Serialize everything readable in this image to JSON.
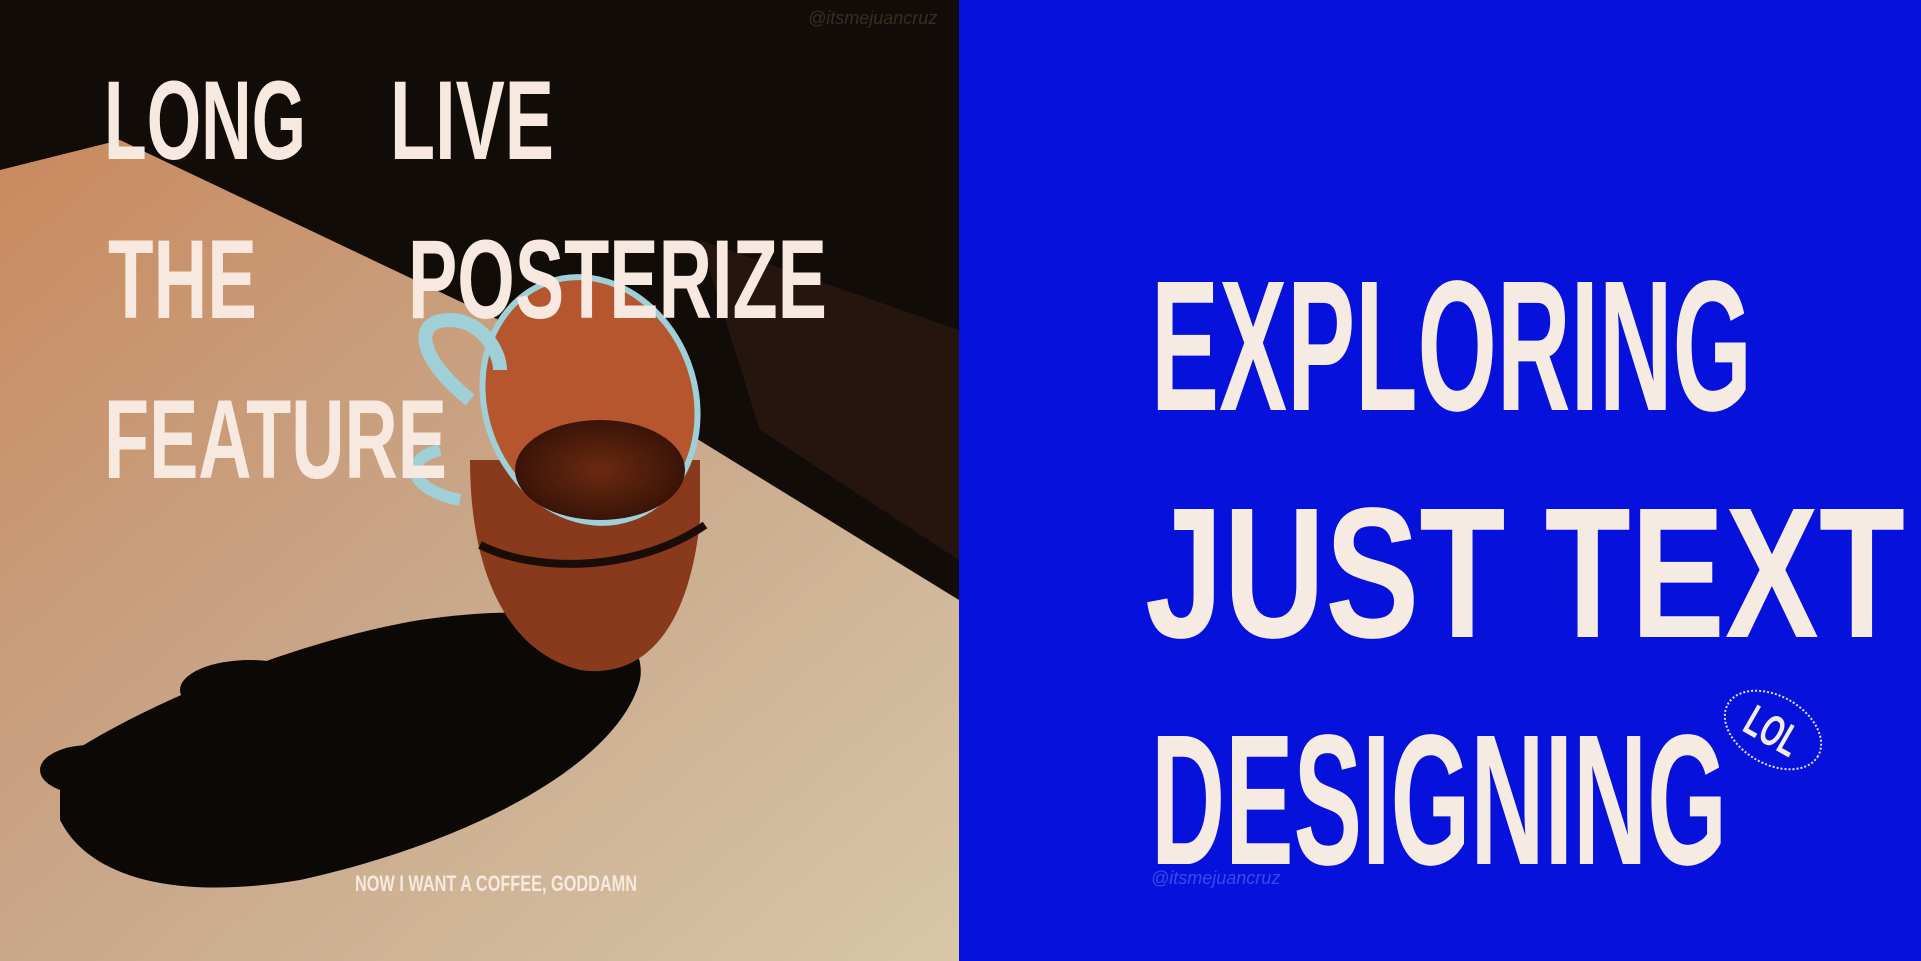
{
  "left_poster": {
    "title_lines": [
      {
        "a": "LONG",
        "b": "LIVE"
      },
      {
        "a": "THE",
        "b": "POSTERIZE"
      },
      {
        "a": "FEATURE",
        "b": ""
      }
    ],
    "caption": "NOW I WANT A COFFEE, GODDAMN",
    "watermark": "@itsmejuancruz"
  },
  "right_poster": {
    "lines": [
      "EXPLORING",
      "JUST TEXT",
      "DESIGNING"
    ],
    "badge": "LOL",
    "watermark": "@itsmejuancruz"
  },
  "colors": {
    "blue": "#0711dc",
    "cream": "#f7e9e0"
  }
}
